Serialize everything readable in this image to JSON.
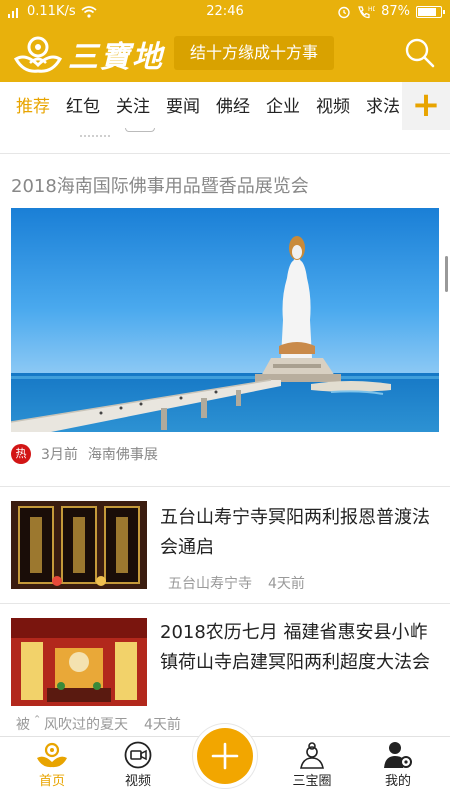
{
  "status_bar": {
    "speed": "0.11K/s",
    "time": "22:46",
    "battery": "87%",
    "battery_level": 0.87
  },
  "header": {
    "brand": "三寶地",
    "slogan": "结十方缘成十方事"
  },
  "tabs": [
    {
      "label": "推荐"
    },
    {
      "label": "红包"
    },
    {
      "label": "关注"
    },
    {
      "label": "要闻"
    },
    {
      "label": "佛经"
    },
    {
      "label": "企业"
    },
    {
      "label": "视频"
    },
    {
      "label": "求法"
    }
  ],
  "add_tab_symbol": "+",
  "feed": {
    "featured": {
      "title": "2018海南国际佛事用品暨香品展览会",
      "badge": "热",
      "time": "3月前",
      "source": "海南佛事展"
    },
    "items": [
      {
        "title": "五台山寿宁寺冥阳两利报恩普渡法会通启",
        "source": "五台山寿宁寺",
        "time": "4天前"
      },
      {
        "title": "2018农历七月 福建省惠安县小岞镇荷山寺启建冥阳两利超度大法会",
        "source": "被＾风吹过的夏天",
        "time": "4天前"
      }
    ]
  },
  "bottom_nav": {
    "home": "首页",
    "video": "视频",
    "sanbao": "三宝圈",
    "mine": "我的"
  },
  "colors": {
    "brand_yellow": "#e8b10c",
    "accent_orange": "#e8a400",
    "hot_red": "#d21515"
  }
}
